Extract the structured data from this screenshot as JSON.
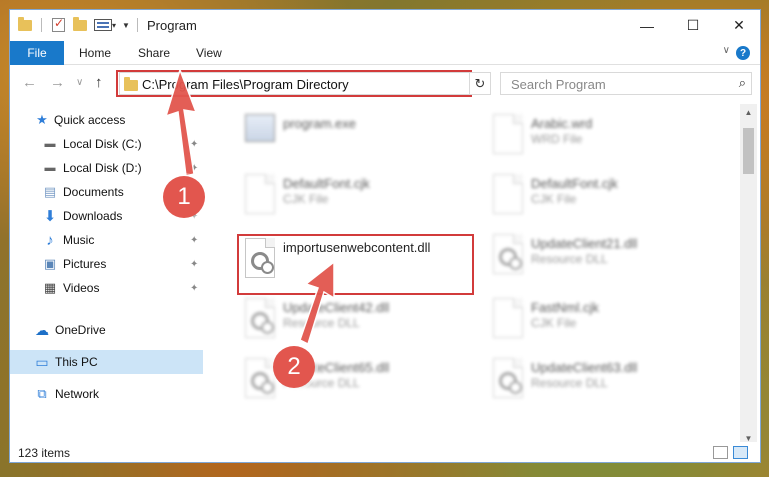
{
  "window": {
    "title": "Program",
    "minimize": "—",
    "maximize": "☐",
    "close": "✕"
  },
  "ribbon": {
    "tabs": [
      "File",
      "Home",
      "Share",
      "View"
    ],
    "help": "?",
    "collapse": "∨"
  },
  "nav": {
    "back": "←",
    "forward": "→",
    "recent": "∨",
    "up": "↑",
    "address": "C:\\Program Files\\Program Directory",
    "address_dropdown": "∨",
    "refresh": "↻",
    "search_placeholder": "Search Program",
    "search_icon": "⌕"
  },
  "sidebar": {
    "items": [
      {
        "label": "Quick access",
        "icon": "star-icon",
        "pinned": false
      },
      {
        "label": "Local Disk (C:)",
        "icon": "drive-icon",
        "pinned": true
      },
      {
        "label": "Local Disk (D:)",
        "icon": "drive-icon",
        "pinned": true
      },
      {
        "label": "Documents",
        "icon": "documents-icon",
        "pinned": true
      },
      {
        "label": "Downloads",
        "icon": "download-icon",
        "pinned": true
      },
      {
        "label": "Music",
        "icon": "music-icon",
        "pinned": true
      },
      {
        "label": "Pictures",
        "icon": "pictures-icon",
        "pinned": true
      },
      {
        "label": "Videos",
        "icon": "videos-icon",
        "pinned": true
      },
      {
        "label": "OneDrive",
        "icon": "cloud-icon",
        "pinned": false
      },
      {
        "label": "This PC",
        "icon": "computer-icon",
        "pinned": false,
        "selected": true
      },
      {
        "label": "Network",
        "icon": "network-icon",
        "pinned": false
      }
    ],
    "pin_glyph": "📌"
  },
  "files": [
    {
      "name": "program.exe",
      "type": "",
      "icon": "exe-icon"
    },
    {
      "name": "Arabic.wrd",
      "type": "WRD File",
      "icon": "file-icon"
    },
    {
      "name": "DefaultFont.cjk",
      "type": "CJK File",
      "icon": "file-icon"
    },
    {
      "name": "DefaultFont.cjk",
      "type": "CJK File",
      "icon": "file-icon"
    },
    {
      "name": "importusenwebcontent.dll",
      "type": "",
      "icon": "dll-icon",
      "highlighted": true
    },
    {
      "name": "UpdateClient21.dll",
      "type": "Resource DLL",
      "icon": "dll-icon"
    },
    {
      "name": "UpdateClient42.dll",
      "type": "Resource DLL",
      "icon": "dll-icon"
    },
    {
      "name": "FastNml.cjk",
      "type": "CJK File",
      "icon": "file-icon"
    },
    {
      "name": "UpdateClient65.dll",
      "type": "Resource DLL",
      "icon": "dll-icon"
    },
    {
      "name": "UpdateClient63.dll",
      "type": "Resource DLL",
      "icon": "dll-icon"
    }
  ],
  "status": {
    "item_count": "123 items"
  },
  "annotations": {
    "step1": "1",
    "step2": "2",
    "color": "#e2564e"
  },
  "colors": {
    "accent": "#1979ca",
    "highlight_box": "#d23b3b",
    "selected_bg": "#cce4f7"
  }
}
